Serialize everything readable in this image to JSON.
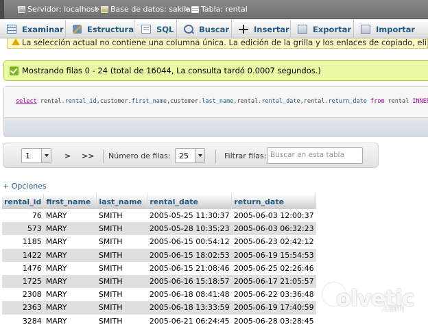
{
  "breadcrumb": {
    "server": "Servidor: localhost",
    "database": "Base de datos: sakila",
    "table": "Tabla: rental",
    "separator": "»"
  },
  "tabs": [
    {
      "label": "Examinar",
      "icon": "browse-icon"
    },
    {
      "label": "Estructura",
      "icon": "structure-icon"
    },
    {
      "label": "SQL",
      "icon": "sql-icon"
    },
    {
      "label": "Buscar",
      "icon": "search-icon"
    },
    {
      "label": "Insertar",
      "icon": "insert-icon"
    },
    {
      "label": "Exportar",
      "icon": "export-icon"
    },
    {
      "label": "Importar",
      "icon": "import-icon"
    }
  ],
  "warning": {
    "text": "La selección actual no contiene una columna única. La edición de la grilla y los enlaces de copiado, eliminación y e"
  },
  "success": {
    "text": "Mostrando filas 0 - 24 (total de 16044, La consulta tardó 0.0007 segundos.)"
  },
  "sql": {
    "select": "select",
    "body1": " rental.",
    "f1": "rental_id",
    "c1": ",customer.",
    "f2": "first_name",
    "c2": ",customer.",
    "f3": "last_name",
    "c3": ",rental.",
    "f4": "rental_date",
    "c4": ",rental.",
    "f5": "return_date",
    "from": " from",
    "table": " rental ",
    "join": "INNER JO"
  },
  "navigation": {
    "page_value": "1",
    "next": ">",
    "last": ">>",
    "rows_label": "Número de filas:",
    "rows_value": "25",
    "filter_label": "Filtrar filas:",
    "filter_placeholder": "Buscar en esta tabla"
  },
  "options_link": "+ Opciones",
  "table": {
    "columns": [
      "rental_id",
      "first_name",
      "last_name",
      "rental_date",
      "return_date"
    ],
    "rows": [
      [
        "76",
        "MARY",
        "SMITH",
        "2005-05-25 11:30:37",
        "2005-06-03 12:00:37"
      ],
      [
        "573",
        "MARY",
        "SMITH",
        "2005-05-28 10:35:23",
        "2005-06-03 06:32:23"
      ],
      [
        "1185",
        "MARY",
        "SMITH",
        "2005-06-15 00:54:12",
        "2005-06-23 02:42:12"
      ],
      [
        "1422",
        "MARY",
        "SMITH",
        "2005-06-15 18:02:53",
        "2005-06-19 15:54:53"
      ],
      [
        "1476",
        "MARY",
        "SMITH",
        "2005-06-15 21:08:46",
        "2005-06-25 02:26:46"
      ],
      [
        "1725",
        "MARY",
        "SMITH",
        "2005-06-16 15:18:57",
        "2005-06-17 21:05:57"
      ],
      [
        "2308",
        "MARY",
        "SMITH",
        "2005-06-18 08:41:48",
        "2005-06-22 03:36:48"
      ],
      [
        "2363",
        "MARY",
        "SMITH",
        "2005-06-18 13:33:59",
        "2005-06-19 17:40:59"
      ],
      [
        "3284",
        "MARY",
        "SMITH",
        "2005-06-21 06:24:45",
        "2005-06-28 03:28:45"
      ]
    ]
  },
  "watermark": {
    "word": "olvetic",
    "domain": ".com"
  },
  "colors": {
    "link": "#235a81",
    "success_bg": "#ebf8a4",
    "warning_bg": "#fff7c6"
  }
}
